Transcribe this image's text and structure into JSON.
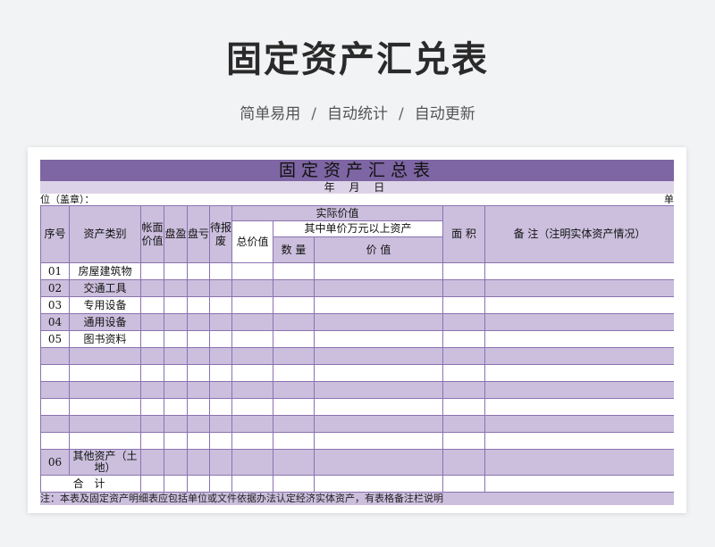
{
  "hero": {
    "title": "固定资产汇兑表",
    "subtitle": [
      "简单易用",
      "自动统计",
      "自动更新"
    ],
    "separator": "/"
  },
  "sheet": {
    "title": "固定资产汇总表",
    "date_label": "年 月 日",
    "unit_left": "位（盖章）：",
    "unit_right": "单",
    "headers": {
      "seq": "序号",
      "category": "资产类别",
      "book_value": "帐面价值",
      "surplus": "盘盈",
      "loss": "盘亏",
      "pending_scrap": "待报废",
      "actual_value": "实际价值",
      "total_value": "总价值",
      "above_10k": "其中单价万元以上资产",
      "quantity": "数 量",
      "value": "价 值",
      "area": "面 积",
      "remarks": "备 注（注明实体资产情况）"
    },
    "rows": [
      {
        "seq": "01",
        "category": "房屋建筑物"
      },
      {
        "seq": "02",
        "category": "交通工具"
      },
      {
        "seq": "03",
        "category": "专用设备"
      },
      {
        "seq": "04",
        "category": "通用设备"
      },
      {
        "seq": "05",
        "category": "图书资料"
      },
      {
        "seq": "",
        "category": ""
      },
      {
        "seq": "",
        "category": ""
      },
      {
        "seq": "",
        "category": ""
      },
      {
        "seq": "",
        "category": ""
      },
      {
        "seq": "",
        "category": ""
      },
      {
        "seq": "",
        "category": ""
      },
      {
        "seq": "06",
        "category": "其他资产（土地）"
      }
    ],
    "total_label": "合 计",
    "note": "注：本表及固定资产明细表应包括单位或文件依据办法认定经济实体资产，有表格备注栏说明"
  },
  "colors": {
    "title_bar": "#7e65a3",
    "header_fill": "#cbbfdd",
    "border": "#8b72b0"
  }
}
